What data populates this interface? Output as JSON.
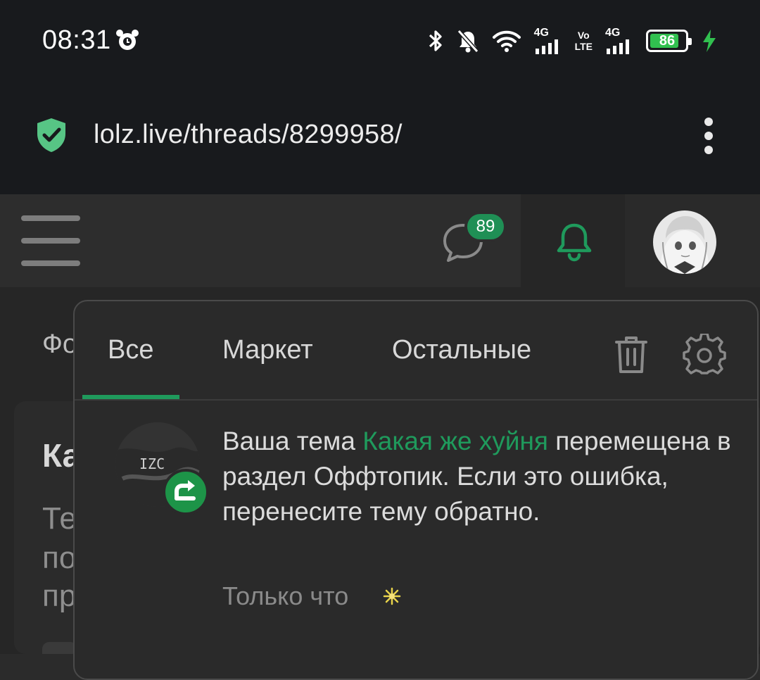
{
  "status_bar": {
    "time": "08:31",
    "network_1": "4G",
    "volte_top": "Vo",
    "volte_bottom": "LTE",
    "network_2": "4G",
    "battery_percent": "86",
    "battery_level": 0.86,
    "battery_color": "#31c04f"
  },
  "browser": {
    "url": "lolz.live/threads/8299958/",
    "shield_color": "#57c585"
  },
  "header": {
    "chat_badge": "89",
    "accent": "#1f9a5c"
  },
  "background": {
    "text_1": "Фо",
    "text_2": "Ка",
    "text_3": "Те",
    "text_4": "по",
    "text_5": "пр"
  },
  "notifications": {
    "tabs": [
      {
        "label": "Все",
        "active": true
      },
      {
        "label": "Маркет",
        "active": false
      },
      {
        "label": "Остальные",
        "active": false
      }
    ],
    "items": [
      {
        "prefix": "Ваша тема ",
        "link": "Какая же хуйня",
        "suffix": " перемещена в раздел Оффтопик. Если это ошибка, перенесите тему обратно.",
        "time": "Только что",
        "avatar_text": "IZC",
        "badge_icon": "move-arrow-icon"
      }
    ]
  },
  "icons": {
    "trash": "trash-icon",
    "settings": "gear-icon",
    "bell": "bell-icon",
    "chat": "chat-bubble-icon"
  }
}
